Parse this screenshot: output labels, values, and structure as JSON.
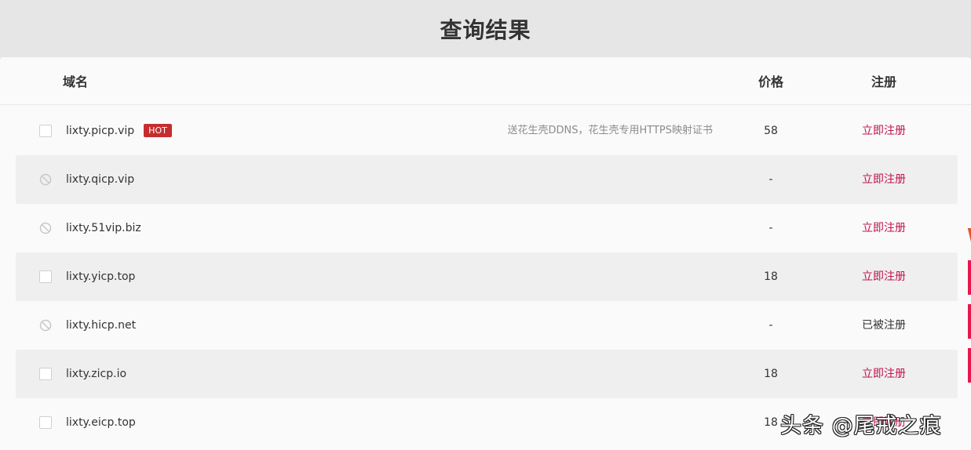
{
  "title": "查询结果",
  "table": {
    "headers": {
      "domain": "域名",
      "price": "价格",
      "register": "注册"
    },
    "rows": [
      {
        "domain": "lixty.picp.vip",
        "badge": "HOT",
        "promo": "送花生壳DDNS，花生壳专用HTTPS映射证书",
        "price": "58",
        "action": "立即注册",
        "available": true,
        "selector": "checkbox"
      },
      {
        "domain": "lixty.qicp.vip",
        "badge": "",
        "promo": "",
        "price": "-",
        "action": "立即注册",
        "available": false,
        "selector": "ban-icon"
      },
      {
        "domain": "lixty.51vip.biz",
        "badge": "",
        "promo": "",
        "price": "-",
        "action": "立即注册",
        "available": false,
        "selector": "ban-icon"
      },
      {
        "domain": "lixty.yicp.top",
        "badge": "",
        "promo": "",
        "price": "18",
        "action": "立即注册",
        "available": true,
        "selector": "checkbox"
      },
      {
        "domain": "lixty.hicp.net",
        "badge": "",
        "promo": "",
        "price": "-",
        "action": "已被注册",
        "available": false,
        "selector": "ban-icon"
      },
      {
        "domain": "lixty.zicp.io",
        "badge": "",
        "promo": "",
        "price": "18",
        "action": "立即注册",
        "available": true,
        "selector": "checkbox"
      },
      {
        "domain": "lixty.eicp.top",
        "badge": "",
        "promo": "",
        "price": "18",
        "action": "立即注册",
        "available": true,
        "selector": "checkbox"
      }
    ]
  },
  "watermark": "头条 @尾戒之痕",
  "colors": {
    "link": "#c1124f",
    "hot_badge": "#c62e2e",
    "side_accent": "#e8174f"
  }
}
